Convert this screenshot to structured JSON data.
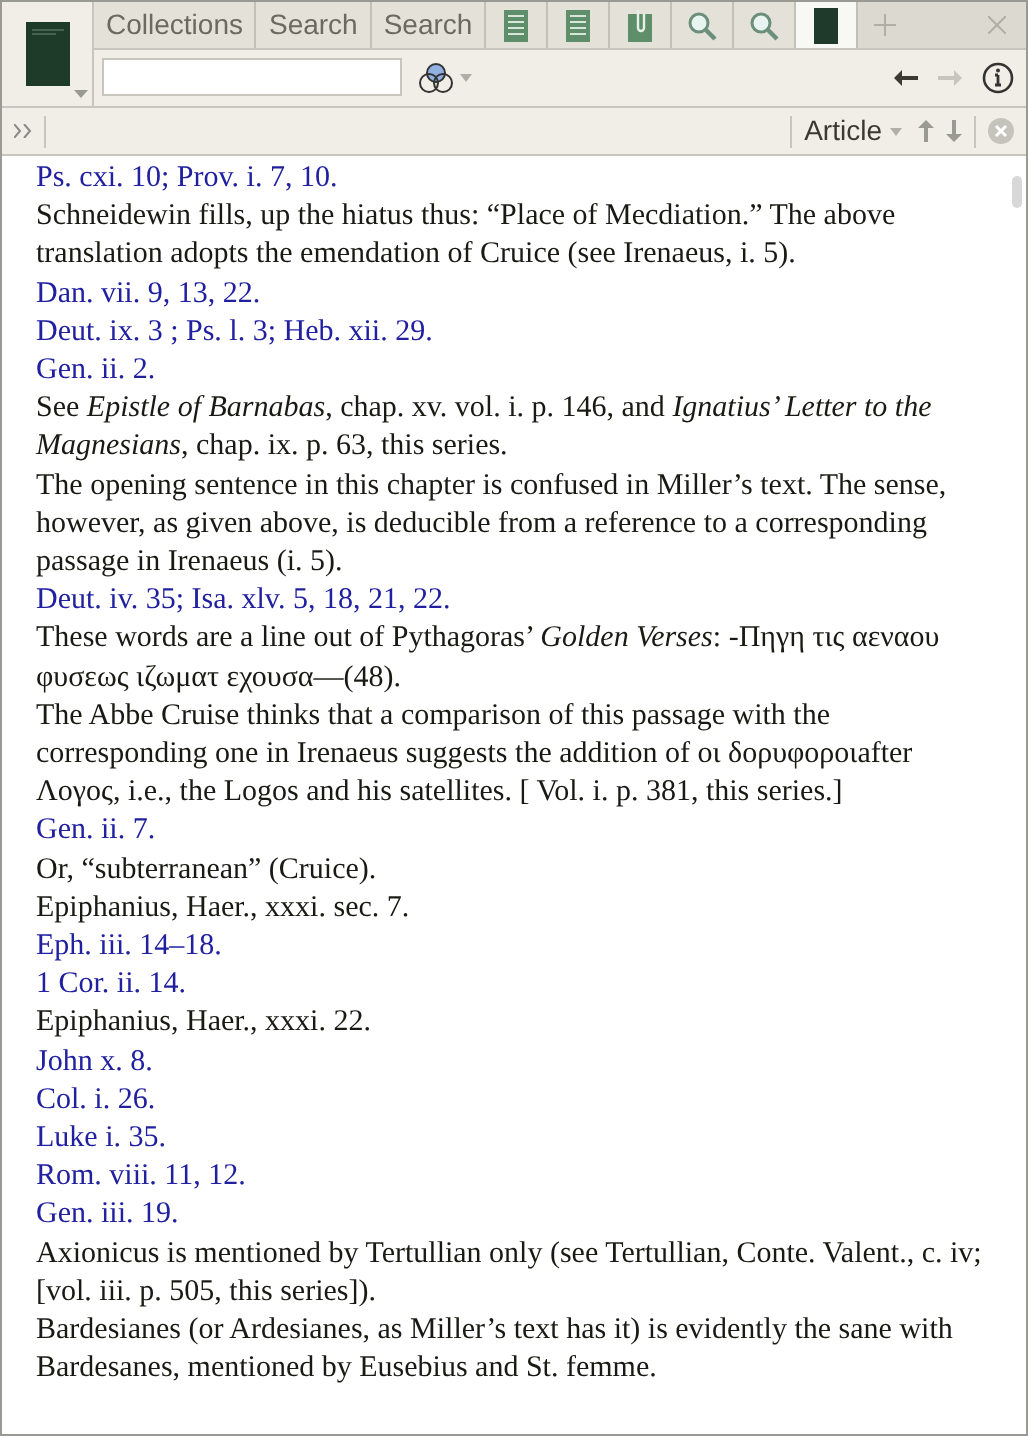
{
  "tabs": [
    {
      "kind": "text",
      "label": "Collections",
      "selected": false
    },
    {
      "kind": "text",
      "label": "Search",
      "selected": false
    },
    {
      "kind": "text",
      "label": "Search",
      "selected": false
    },
    {
      "kind": "document",
      "selected": false
    },
    {
      "kind": "document",
      "selected": false
    },
    {
      "kind": "clip",
      "selected": false
    },
    {
      "kind": "search",
      "selected": false
    },
    {
      "kind": "search",
      "selected": false
    },
    {
      "kind": "book",
      "selected": true
    }
  ],
  "nav": {
    "back_disabled": false,
    "forward_disabled": true
  },
  "panel": {
    "mode": "Article"
  },
  "notes": [
    {
      "kind": "ref",
      "text": "Ps. cxi. 10; Prov. i. 7, 10."
    },
    {
      "kind": "text",
      "text": "Schneidewin fills, up the hiatus thus: “Place of Mecdiation.” The above translation adopts the emendation of Cruice (see Irenaeus, i. 5)."
    },
    {
      "kind": "ref",
      "text": "Dan. vii. 9, 13, 22."
    },
    {
      "kind": "ref",
      "text": "Deut. ix. 3 ; Ps. l. 3; Heb. xii. 29."
    },
    {
      "kind": "ref",
      "text": "Gen. ii. 2."
    },
    {
      "kind": "text",
      "text": "See *Epistle of Barnabas*, chap. xv. vol. i. p. 146, and *Ignatius’ Letter to the Magnesians*, chap. ix. p. 63, this series."
    },
    {
      "kind": "text",
      "text": "The opening sentence in this chapter is confused in Miller’s text. The sense, however, as given above, is deducible from a reference to a corresponding passage in Irenaeus (i. 5)."
    },
    {
      "kind": "ref",
      "text": "Deut. iv. 35; Isa. xlv. 5, 18, 21, 22."
    },
    {
      "kind": "text",
      "text": "These words are a line out of Pythagoras’ *Golden Verses*: -Πηγη τις αεναου φυσεως ιζωματ εχουσα—(48)."
    },
    {
      "kind": "text",
      "text": "The Abbe Cruise thinks that a comparison of this passage with the corresponding one in Irenaeus suggests the addition of οι δορυφοροιafter Λογος, i.e., the Logos and his satellites. [ Vol. i. p. 381, this series.]"
    },
    {
      "kind": "ref",
      "text": "Gen. ii. 7."
    },
    {
      "kind": "text",
      "text": "Or, “subterranean” (Cruice)."
    },
    {
      "kind": "text",
      "text": "Epiphanius, Haer., xxxi. sec. 7."
    },
    {
      "kind": "ref",
      "text": "Eph. iii. 14–18."
    },
    {
      "kind": "ref",
      "text": "1 Cor. ii. 14."
    },
    {
      "kind": "text",
      "text": "Epiphanius, Haer., xxxi. 22."
    },
    {
      "kind": "ref",
      "text": "John x. 8."
    },
    {
      "kind": "ref",
      "text": "Col. i. 26."
    },
    {
      "kind": "ref",
      "text": "Luke i. 35."
    },
    {
      "kind": "ref",
      "text": "Rom. viii. 11, 12."
    },
    {
      "kind": "ref",
      "text": "Gen. iii. 19."
    },
    {
      "kind": "text",
      "text": "Axionicus is mentioned by Tertullian only (see Tertullian, Conte. Valent., c. iv; [vol. iii. p. 505, this series])."
    },
    {
      "kind": "text",
      "text": "Bardesianes (or Ardesianes, as Miller’s text has it) is evidently the sane with Bardesanes, mentioned by Eusebius and St. femme."
    }
  ]
}
